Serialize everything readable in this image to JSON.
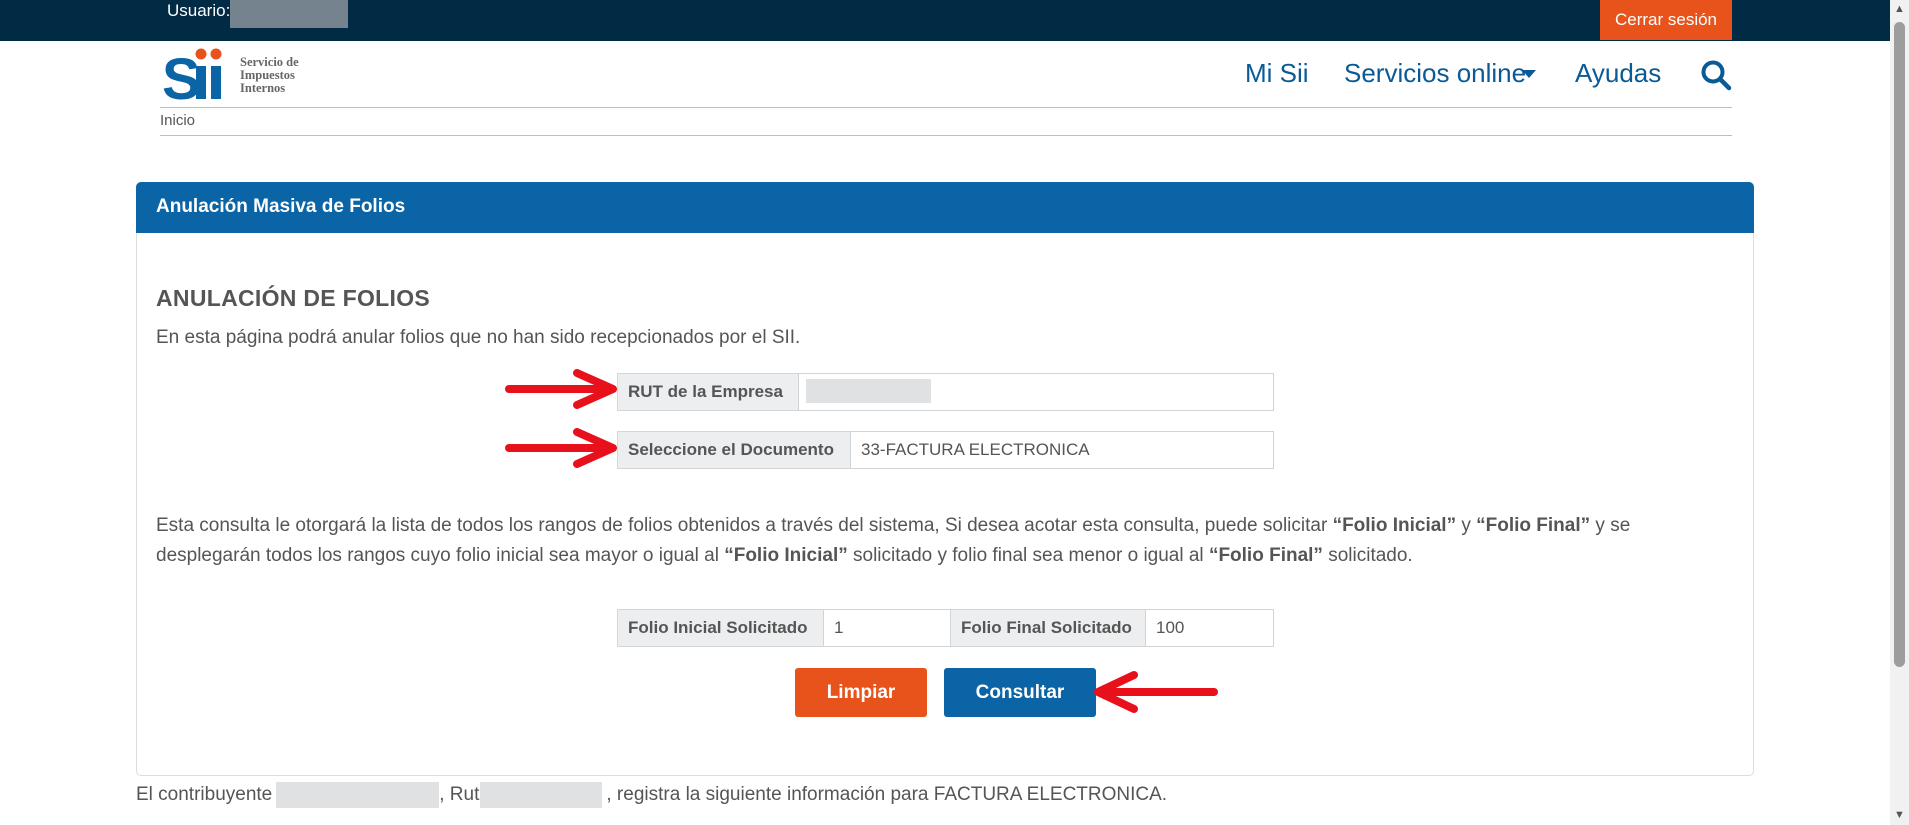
{
  "topbar": {
    "usuario_label": "Usuario:",
    "logout_label": "Cerrar sesión"
  },
  "header": {
    "logo_lines": [
      "Servicio de",
      "Impuestos",
      "Internos"
    ],
    "logo_mark": "Sii",
    "nav": {
      "mi_sii": "Mi Sii",
      "servicios": "Servicios online",
      "ayudas": "Ayudas"
    },
    "breadcrumb": "Inicio"
  },
  "panel": {
    "title": "Anulación Masiva de Folios",
    "section_title": "ANULACIÓN DE FOLIOS",
    "intro": "En esta página podrá anular folios que no han sido recepcionados por el SII.",
    "rut_label": "RUT de la Empresa",
    "rut_value": "",
    "documento_label": "Seleccione el Documento",
    "documento_value": "33-FACTURA ELECTRONICA",
    "info_parts": [
      "Esta consulta le otorgará la lista de todos los rangos de folios obtenidos a través del sistema, Si desea acotar esta consulta, puede solicitar ",
      "“Folio Inicial”",
      " y ",
      "“Folio Final”",
      " y se desplegarán todos los rangos cuyo folio inicial sea mayor o igual al ",
      "“Folio Inicial”",
      " solicitado y folio final sea menor o igual al ",
      "“Folio Final”",
      " solicitado."
    ],
    "folio_inicial_label": "Folio Inicial Solicitado",
    "folio_inicial_value": "1",
    "folio_final_label": "Folio Final Solicitado",
    "folio_final_value": "100",
    "limpiar_label": "Limpiar",
    "consultar_label": "Consultar"
  },
  "footer": {
    "part1": "El contribuyente",
    "part2": ", Rut",
    "part3": ", registra la siguiente información para FACTURA ELECTRONICA."
  },
  "colors": {
    "topbar": "#012a45",
    "primary": "#0a64a6",
    "accent": "#e8531b",
    "annotation_arrow": "#e8101b"
  }
}
